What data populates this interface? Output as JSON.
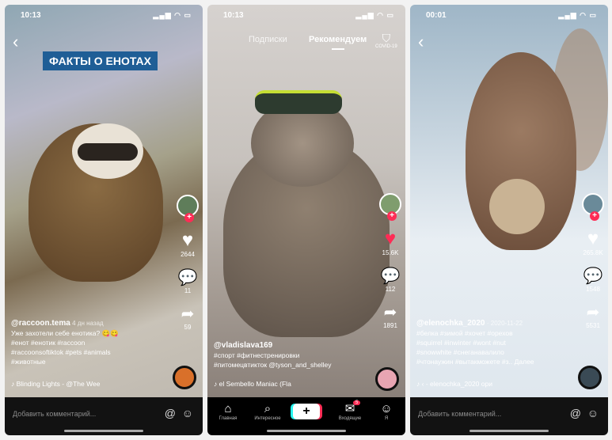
{
  "phone1": {
    "time": "10:13",
    "banner": "ФАКТЫ О ЕНОТАХ",
    "rail": {
      "likes": "2644",
      "comments": "11",
      "shares": "59"
    },
    "caption": {
      "user": "@raccoon.tema",
      "date": "4 дн назад",
      "line1": "Уже захотели себе енотика? 😋😋",
      "line2": "#енот #енотик #raccoon",
      "line3": "#raccoonsoftiktok #pets #animals",
      "line4": "#животные"
    },
    "music": "Blinding Lights - @The Wee",
    "comment_placeholder": "Добавить комментарий..."
  },
  "phone2": {
    "time": "10:13",
    "tabs": {
      "following": "Подписки",
      "for_you": "Рекомендуем",
      "covid": "COVID-19"
    },
    "rail": {
      "likes": "15.6K",
      "comments": "112",
      "shares": "1891"
    },
    "caption": {
      "user": "@vladislava169",
      "line1": "#спорт #фитнестренировки",
      "line2": "#питомецвтикток @tyson_and_shelley"
    },
    "music": "el Sembello   Maniac (Fla",
    "nav": {
      "home": "Главная",
      "discover": "Интересное",
      "inbox": "Входящие",
      "me": "Я",
      "inbox_badge": "5"
    }
  },
  "phone3": {
    "time": "00:01",
    "rail": {
      "likes": "265.8K",
      "comments": "1548",
      "shares": "5531"
    },
    "caption": {
      "user": "@elenochka_2020",
      "date": "· 2020-11-22",
      "line1": "#белка #зимой #хочет #орехов",
      "line2": "#squirrel #inwinter #wont #nut",
      "line3": "#snowwhite #снеганавалило",
      "line4": "#чтонаужин #вытакможете #з.. Далее"
    },
    "music": "‹ - elenochka_2020   ори",
    "comment_placeholder": "Добавить комментарий..."
  }
}
